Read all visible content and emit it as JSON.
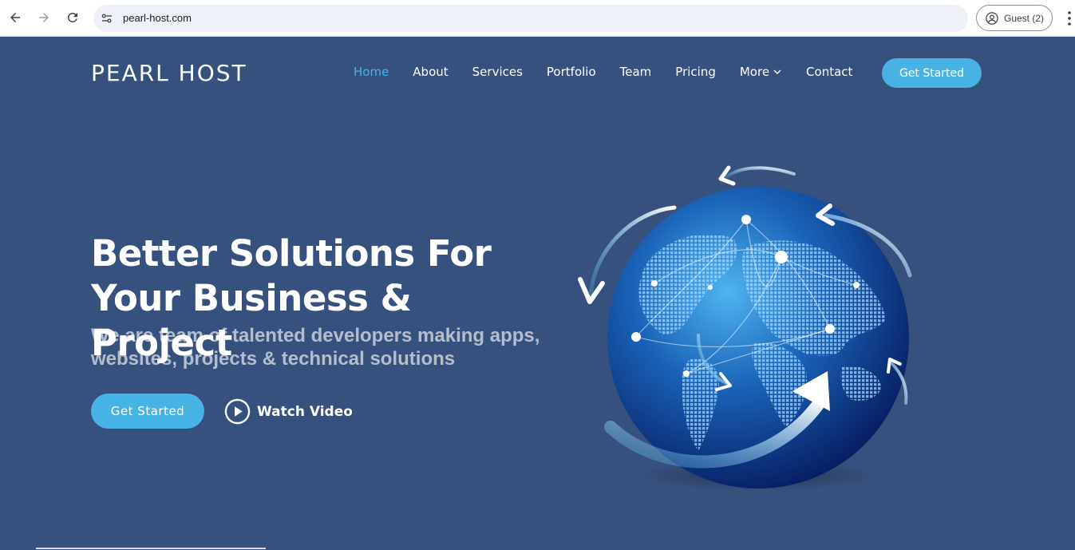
{
  "browser": {
    "url": "pearl-host.com",
    "profile_label": "Guest (2)"
  },
  "site": {
    "logo": "PEARL HOST",
    "nav": [
      {
        "label": "Home",
        "active": true
      },
      {
        "label": "About"
      },
      {
        "label": "Services"
      },
      {
        "label": "Portfolio"
      },
      {
        "label": "Team"
      },
      {
        "label": "Pricing"
      },
      {
        "label": "More"
      },
      {
        "label": "Contact"
      }
    ],
    "header_cta": "Get Started"
  },
  "hero": {
    "title_line1": "Better Solutions For",
    "title_line2": "Your Business & Project",
    "subtitle_line1": "We are team of talented developers making apps,",
    "subtitle_line2": "websites, projects & technical solutions",
    "cta": "Get Started",
    "watch_video": "Watch Video"
  },
  "colors": {
    "background": "#37517e",
    "accent": "#47b2e4",
    "text": "#ffffff"
  },
  "icons": {
    "back": "arrow-left-icon",
    "forward": "arrow-right-icon",
    "reload": "reload-icon",
    "site_info": "site-settings-icon",
    "profile": "account-circle-icon",
    "menu": "more-vertical-icon",
    "dropdown": "chevron-down-icon",
    "play": "play-circle-icon",
    "hero_image": "globe-network-illustration"
  }
}
